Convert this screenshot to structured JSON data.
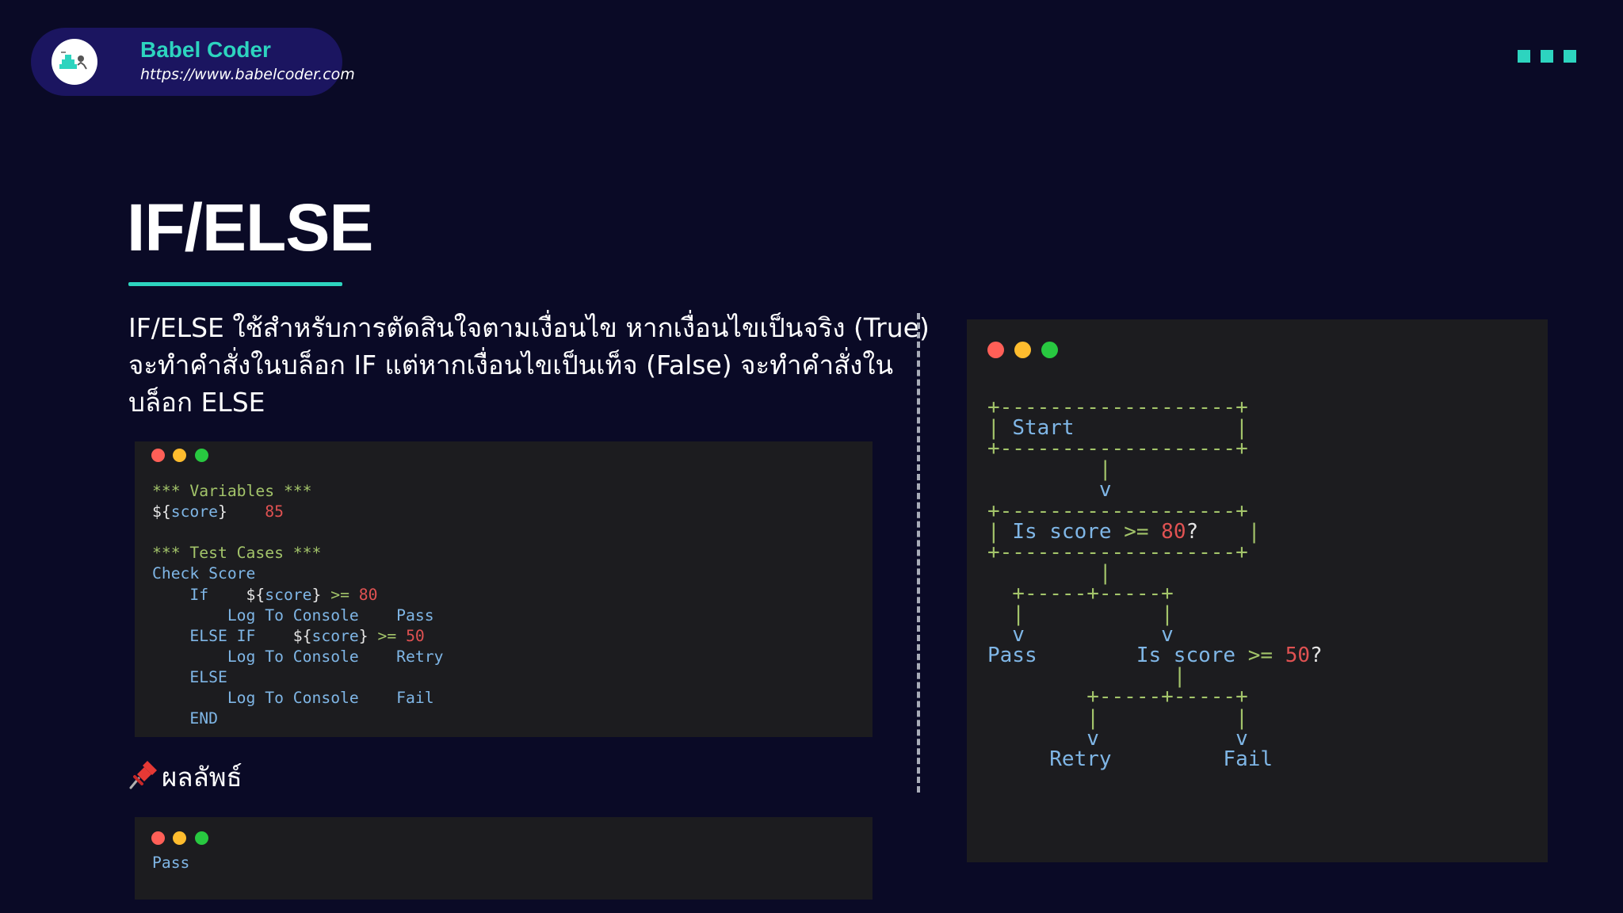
{
  "brand": {
    "name": "Babel Coder",
    "url": "https://www.babelcoder.com",
    "logo_icon": "babel-coder-logo"
  },
  "menu_icon": "three-squares-menu-icon",
  "colors": {
    "background": "#0a0a26",
    "accent": "#2dd4bf",
    "code_background": "#1c1c1f",
    "code_blue": "#7fb6e6",
    "code_green": "#a3c46a",
    "code_red": "#e05252",
    "traffic_red": "#ff5f57",
    "traffic_yellow": "#febc2e",
    "traffic_green": "#28c840"
  },
  "slide": {
    "title": "IF/ELSE",
    "description_lines": [
      "IF/ELSE ใช้สำหรับการตัดสินใจตามเงื่อนไข หากเงื่อนไขเป็นจริง (True)",
      "จะทำคำสั่งในบล็อก IF แต่หากเงื่อนไขเป็นเท็จ (False) จะทำคำสั่งใน",
      "บล็อก ELSE"
    ],
    "result_heading": "ผลลัพธ์",
    "result_icon": "pushpin-icon"
  },
  "code_window": {
    "lines": [
      [],
      [
        {
          "t": "*** Variables ***",
          "c": "comment"
        }
      ],
      [
        {
          "t": "${",
          "c": "var"
        },
        {
          "t": "score",
          "c": "plain"
        },
        {
          "t": "}",
          "c": "var"
        },
        {
          "t": "    ",
          "c": "plain"
        },
        {
          "t": "85",
          "c": "num"
        }
      ],
      [],
      [
        {
          "t": "*** Test Cases ***",
          "c": "comment"
        }
      ],
      [
        {
          "t": "Check Score",
          "c": "plain"
        }
      ],
      [
        {
          "t": "    If    ",
          "c": "plain"
        },
        {
          "t": "${",
          "c": "var"
        },
        {
          "t": "score",
          "c": "plain"
        },
        {
          "t": "}",
          "c": "var"
        },
        {
          "t": " >= ",
          "c": "comment"
        },
        {
          "t": "80",
          "c": "num"
        }
      ],
      [
        {
          "t": "        Log To Console    Pass",
          "c": "plain"
        }
      ],
      [
        {
          "t": "    ELSE IF    ",
          "c": "plain"
        },
        {
          "t": "${",
          "c": "var"
        },
        {
          "t": "score",
          "c": "plain"
        },
        {
          "t": "}",
          "c": "var"
        },
        {
          "t": " >= ",
          "c": "comment"
        },
        {
          "t": "50",
          "c": "num"
        }
      ],
      [
        {
          "t": "        Log To Console    Retry",
          "c": "plain"
        }
      ],
      [
        {
          "t": "    ELSE",
          "c": "plain"
        }
      ],
      [
        {
          "t": "        Log To Console    Fail",
          "c": "plain"
        }
      ],
      [
        {
          "t": "    END",
          "c": "plain"
        }
      ]
    ]
  },
  "output_window": {
    "lines": [
      [],
      [
        {
          "t": "Pass",
          "c": "plain"
        }
      ]
    ]
  },
  "flowchart": {
    "lines": [
      [],
      [
        {
          "t": "+-------------------+",
          "c": "border"
        }
      ],
      [
        {
          "t": "| ",
          "c": "border"
        },
        {
          "t": "Start",
          "c": "text"
        },
        {
          "t": "             |",
          "c": "border"
        }
      ],
      [
        {
          "t": "+-------------------+",
          "c": "border"
        }
      ],
      [
        {
          "t": "         |",
          "c": "border"
        }
      ],
      [
        {
          "t": "         v",
          "c": "text"
        }
      ],
      [
        {
          "t": "+-------------------+",
          "c": "border"
        }
      ],
      [
        {
          "t": "| ",
          "c": "border"
        },
        {
          "t": "Is score ",
          "c": "text"
        },
        {
          "t": ">=",
          "c": "border"
        },
        {
          "t": " ",
          "c": "text"
        },
        {
          "t": "80",
          "c": "num"
        },
        {
          "t": "?",
          "c": "mark"
        },
        {
          "t": "    |",
          "c": "border"
        }
      ],
      [
        {
          "t": "+-------------------+",
          "c": "border"
        }
      ],
      [
        {
          "t": "         |",
          "c": "border"
        }
      ],
      [
        {
          "t": "  +-----+-----+",
          "c": "border"
        }
      ],
      [
        {
          "t": "  |           |",
          "c": "border"
        }
      ],
      [
        {
          "t": "  v           v",
          "c": "text"
        }
      ],
      [
        {
          "t": "Pass",
          "c": "text"
        },
        {
          "t": "        Is score ",
          "c": "text"
        },
        {
          "t": ">=",
          "c": "border"
        },
        {
          "t": " ",
          "c": "text"
        },
        {
          "t": "50",
          "c": "num"
        },
        {
          "t": "?",
          "c": "mark"
        }
      ],
      [
        {
          "t": "               |",
          "c": "border"
        }
      ],
      [
        {
          "t": "        +-----+-----+",
          "c": "border"
        }
      ],
      [
        {
          "t": "        |           |",
          "c": "border"
        }
      ],
      [
        {
          "t": "        v           v",
          "c": "text"
        }
      ],
      [
        {
          "t": "     Retry         Fail",
          "c": "text"
        }
      ]
    ]
  }
}
